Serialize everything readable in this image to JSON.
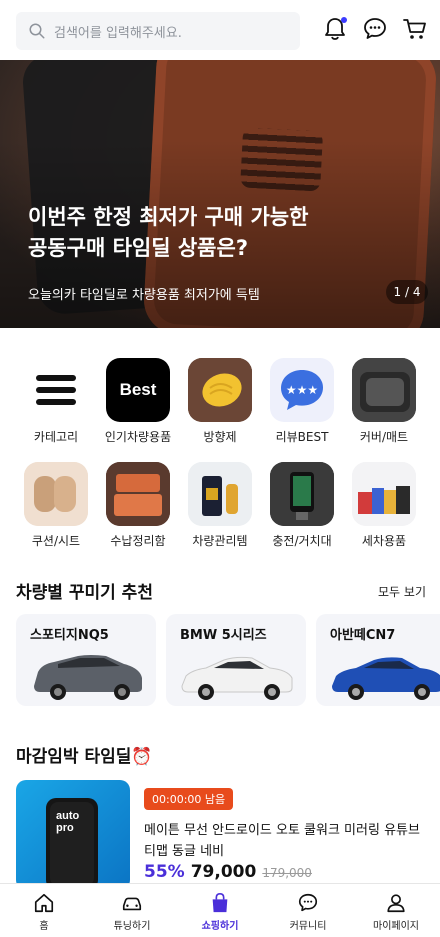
{
  "header": {
    "search_placeholder": "검색어를 입력해주세요."
  },
  "banner": {
    "title": "이번주 한정 최저가 구매 가능한\n공동구매 타임딜 상품은?",
    "subtitle": "오늘의카 타임딜로 차량용품 최저가에 득템",
    "pager": "1 / 4"
  },
  "categories": [
    {
      "label": "카테고리",
      "icon": "menu-icon"
    },
    {
      "label": "인기차량용품",
      "badge": "Best"
    },
    {
      "label": "방향제",
      "icon": "air-freshener"
    },
    {
      "label": "리뷰BEST",
      "icon": "review-bubble"
    },
    {
      "label": "커버/매트",
      "icon": "floor-mat"
    },
    {
      "label": "쿠션/시트",
      "icon": "cushion"
    },
    {
      "label": "수납정리함",
      "icon": "storage-box"
    },
    {
      "label": "차량관리템",
      "icon": "car-care"
    },
    {
      "label": "충전/거치대",
      "icon": "phone-charger"
    },
    {
      "label": "세차용품",
      "icon": "car-wash"
    }
  ],
  "car_section": {
    "title": "차량별 꾸미기 추천",
    "see_all": "모두 보기",
    "cars": [
      {
        "name": "스포티지NQ5",
        "color": "#5b6068"
      },
      {
        "name": "BMW 5시리즈",
        "color": "#f2f2f2"
      },
      {
        "name": "아반떼CN7",
        "color": "#1f4fb5"
      }
    ]
  },
  "deal_section": {
    "title": "마감임박 타임딜⏰",
    "timer": "00:00:00 남음",
    "product_name": "메이튼 무선 안드로이드 오토 쿨워크 미러링 유튜브 티맵 동글 네비",
    "discount": "55%",
    "price": "79,000",
    "original_price": "179,000",
    "thumb_text": "auto\npro"
  },
  "nav": [
    {
      "label": "홈",
      "icon": "home-icon"
    },
    {
      "label": "튜닝하기",
      "icon": "car-icon"
    },
    {
      "label": "쇼핑하기",
      "icon": "shopping-bag-icon",
      "active": true
    },
    {
      "label": "커뮤니티",
      "icon": "chat-icon"
    },
    {
      "label": "마이페이지",
      "icon": "user-icon"
    }
  ],
  "colors": {
    "accent": "#4a2fd9",
    "timer_badge": "#e84b1c"
  }
}
